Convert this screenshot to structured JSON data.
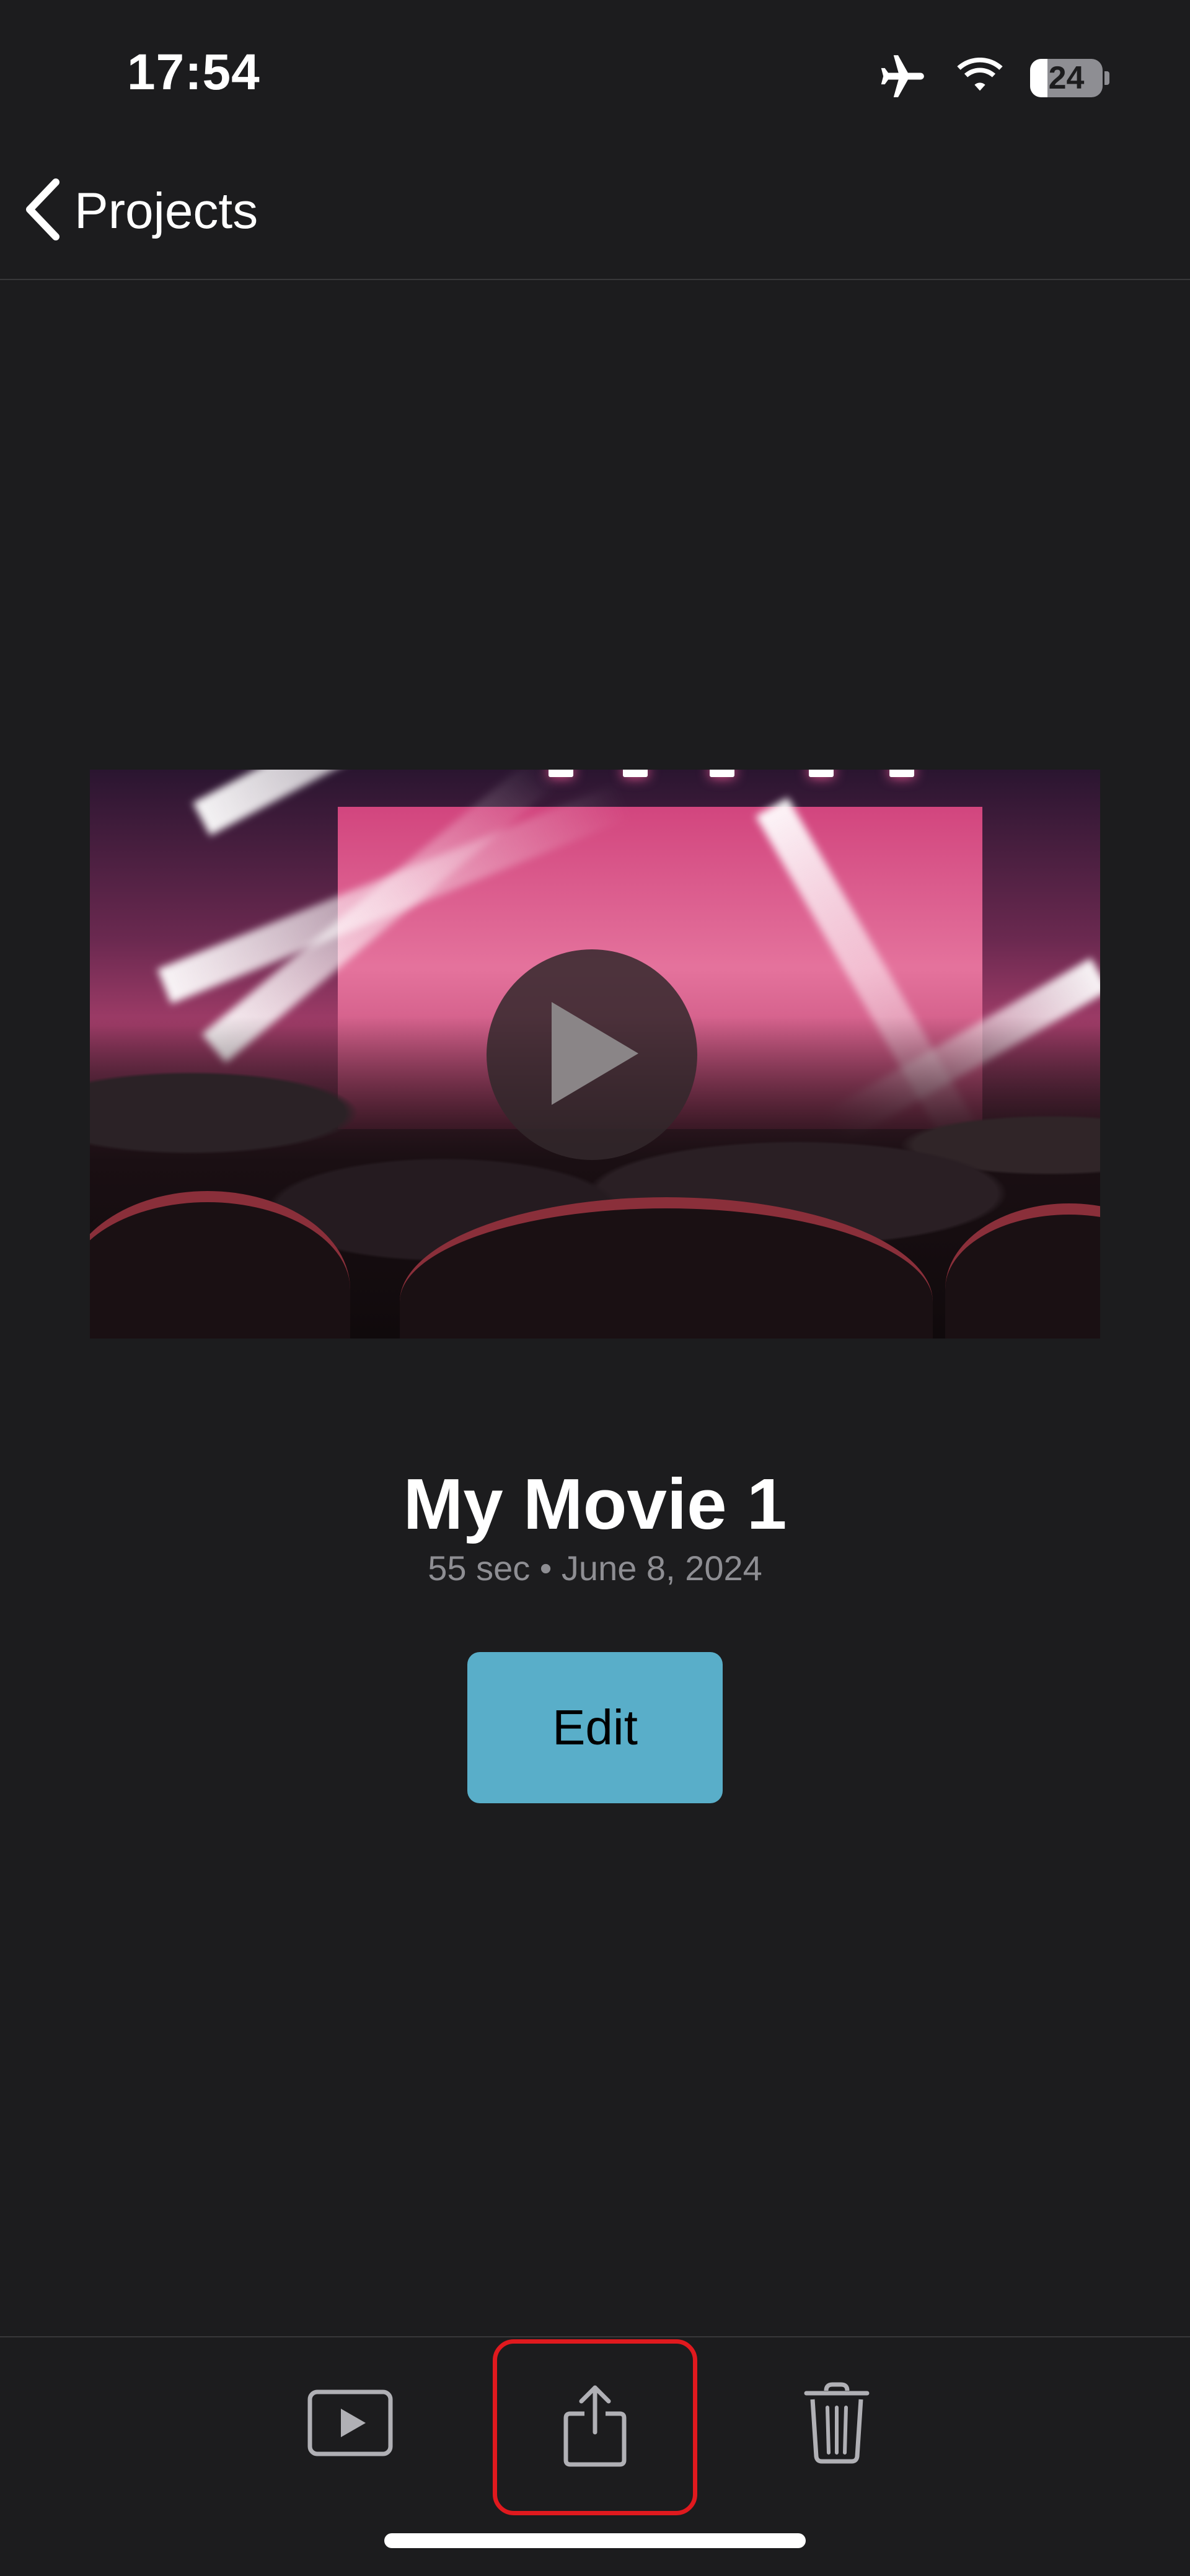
{
  "status_bar": {
    "time": "17:54",
    "battery_level": "24",
    "icons": [
      "airplane-mode-icon",
      "wifi-icon",
      "battery-icon"
    ]
  },
  "nav": {
    "back_label": "Projects"
  },
  "project": {
    "title": "My Movie 1",
    "meta": "55 sec • June 8, 2024",
    "edit_label": "Edit"
  },
  "toolbar": {
    "items": [
      "play-icon",
      "share-icon",
      "trash-icon"
    ]
  },
  "colors": {
    "background": "#1c1c1e",
    "accent": "#59aec9",
    "highlight": "#e0191e",
    "secondary_text": "#8e8e93"
  }
}
